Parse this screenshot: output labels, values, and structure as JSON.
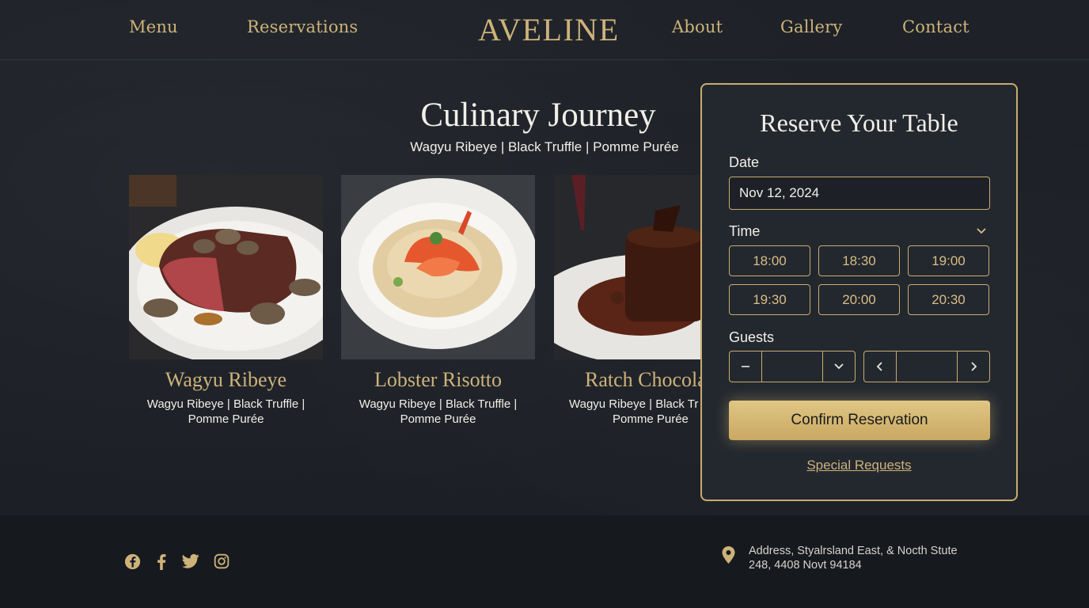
{
  "nav": {
    "brand": "AVELINE",
    "links": [
      "Menu",
      "Reservations",
      "About",
      "Gallery",
      "Contact"
    ]
  },
  "hero": {
    "title": "Culinary Journey",
    "subtitle": "Wagyu Ribeye | Black Truffle | Pomme Purée"
  },
  "dishes": [
    {
      "name": "Wagyu Ribeye",
      "desc_line1": "Wagyu Ribeye | Black Truffle |",
      "desc_line2": "Pomme Purée",
      "image": "steak-plate-image"
    },
    {
      "name": "Lobster Risotto",
      "desc_line1": "Wagyu Ribeye | Black Truffle |",
      "desc_line2": "Pomme Purée",
      "image": "lobster-risotto-image"
    },
    {
      "name": "Ratch Chocola",
      "desc_line1": "Wagyu Ribeye | Black Tr",
      "desc_line2": "Pomme Purée",
      "image": "chocolate-cake-image"
    }
  ],
  "reservation": {
    "title": "Reserve Your Table",
    "date_label": "Date",
    "date_value": "Nov 12, 2024",
    "time_label": "Time",
    "times": [
      "18:00",
      "18:30",
      "19:00",
      "19:30",
      "20:00",
      "20:30"
    ],
    "guests_label": "Guests",
    "confirm_label": "Confirm Reservation",
    "special_requests": "Special Requests"
  },
  "footer": {
    "social_icons": [
      "facebook-circle-icon",
      "facebook-icon",
      "twitter-icon",
      "instagram-icon"
    ],
    "address_line1": "Address, Styalrsland East, & Nocth Stute",
    "address_line2": "248, 4408 Novt 94184"
  },
  "colors": {
    "background": "#1c2026",
    "gold": "#cdb27a",
    "panel": "#23282f",
    "footer": "#16191e"
  }
}
